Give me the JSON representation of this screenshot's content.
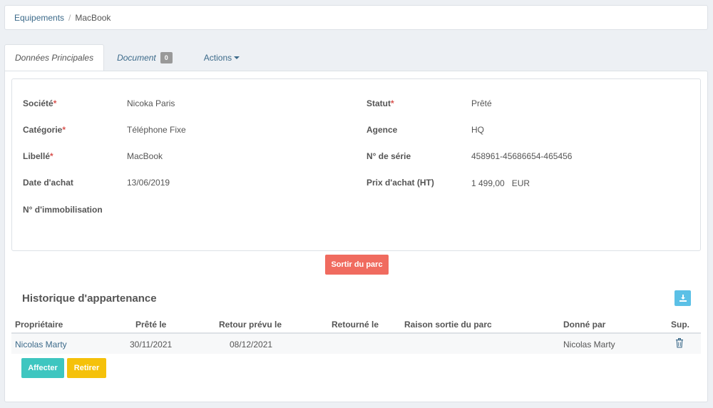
{
  "breadcrumb": {
    "parent": "Equipements",
    "separator": "/",
    "current": "MacBook"
  },
  "tabs": {
    "main": "Données Principales",
    "document": "Document",
    "document_count": "0",
    "actions": "Actions"
  },
  "fields": {
    "societe": {
      "label": "Société",
      "required": "*",
      "value": "Nicoka Paris"
    },
    "categorie": {
      "label": "Catégorie",
      "required": "*",
      "value": "Téléphone Fixe"
    },
    "libelle": {
      "label": "Libellé",
      "required": "*",
      "value": "MacBook"
    },
    "date_achat": {
      "label": "Date d'achat",
      "value": "13/06/2019"
    },
    "immobilisation": {
      "label": "N° d'immobilisation",
      "value": ""
    },
    "statut": {
      "label": "Statut",
      "required": "*",
      "value": "Prêté"
    },
    "agence": {
      "label": "Agence",
      "value": "HQ"
    },
    "serie": {
      "label": "N° de série",
      "value": "458961-45686654-465456"
    },
    "prix": {
      "label": "Prix d'achat (HT)",
      "value": "1 499,00",
      "currency": "EUR"
    }
  },
  "buttons": {
    "exit": "Sortir du parc",
    "assign": "Affecter",
    "remove": "Retirer"
  },
  "history": {
    "title": "Historique d'appartenance",
    "columns": [
      "Propriétaire",
      "Prêté le",
      "Retour prévu le",
      "Retourné le",
      "Raison sortie du parc",
      "Donné par",
      "Sup."
    ],
    "rows": [
      {
        "owner": "Nicolas Marty",
        "lent": "30/11/2021",
        "planned_return": "08/12/2021",
        "returned": "",
        "exit_reason": "",
        "given_by": "Nicolas Marty"
      }
    ]
  },
  "colors": {
    "link": "#3c6a8a",
    "required": "#d9534f",
    "exit_button": "#f06b5f",
    "assign_button": "#3ec6c0",
    "remove_button": "#f5c10a",
    "download_button": "#5bc0e6"
  },
  "icons": {
    "download": "download-icon",
    "delete": "trash-icon",
    "dropdown": "caret-down-icon"
  }
}
